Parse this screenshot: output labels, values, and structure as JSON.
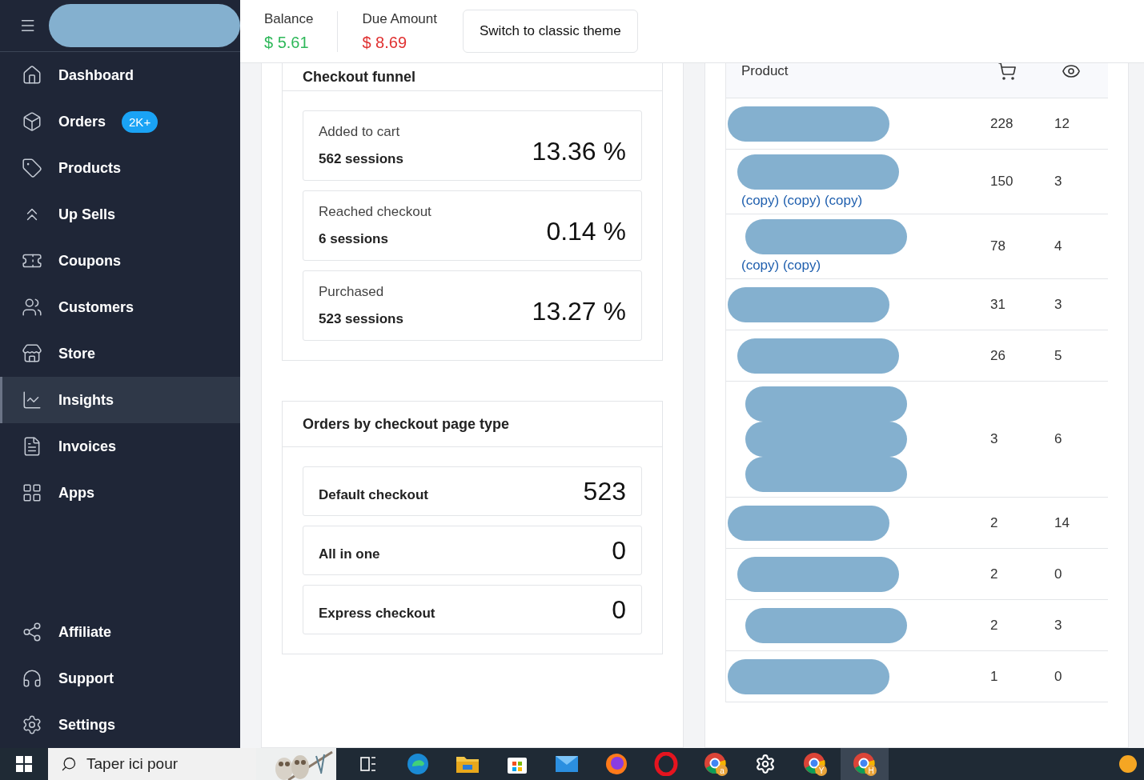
{
  "sidebar": {
    "items": [
      {
        "label": "Dashboard",
        "selected": false
      },
      {
        "label": "Orders",
        "selected": false,
        "badge": "2K+"
      },
      {
        "label": "Products",
        "selected": false
      },
      {
        "label": "Up Sells",
        "selected": false
      },
      {
        "label": "Coupons",
        "selected": false
      },
      {
        "label": "Customers",
        "selected": false
      },
      {
        "label": "Store",
        "selected": false
      },
      {
        "label": "Insights",
        "selected": true
      },
      {
        "label": "Invoices",
        "selected": false
      },
      {
        "label": "Apps",
        "selected": false
      }
    ],
    "bottom_items": [
      {
        "label": "Affiliate",
        "selected": false
      },
      {
        "label": "Support",
        "selected": false
      },
      {
        "label": "Settings",
        "selected": false
      }
    ]
  },
  "header": {
    "stats": [
      {
        "label": "Balance",
        "value": "$ 5.61",
        "color": "#2fb85a"
      },
      {
        "label": "Due Amount",
        "value": "$ 8.69",
        "color": "#e03131"
      }
    ],
    "theme_button": "Switch to classic theme"
  },
  "funnel": {
    "title": "Checkout funnel",
    "steps": [
      {
        "label": "Added to cart",
        "sessions": "562 sessions",
        "percent": "13.36 %"
      },
      {
        "label": "Reached checkout",
        "sessions": "6 sessions",
        "percent": "0.14 %"
      },
      {
        "label": "Purchased",
        "sessions": "523 sessions",
        "percent": "13.27 %"
      }
    ]
  },
  "checkout_types": {
    "title": "Orders by checkout page type",
    "rows": [
      {
        "label": "Default checkout",
        "value": "523"
      },
      {
        "label": "All in one",
        "value": "0"
      },
      {
        "label": "Express checkout",
        "value": "0"
      }
    ]
  },
  "products": {
    "columns": [
      "Product"
    ],
    "rows": [
      {
        "kind": "single",
        "cart": "228",
        "views": "12"
      },
      {
        "kind": "single",
        "name": "(copy) (copy) (copy)",
        "cart": "150",
        "views": "3"
      },
      {
        "kind": "single",
        "name": "(copy) (copy)",
        "cart": "78",
        "views": "4"
      },
      {
        "kind": "single",
        "cart": "31",
        "views": "3"
      },
      {
        "kind": "single",
        "cart": "26",
        "views": "5"
      },
      {
        "kind": "stacked",
        "cart": "3",
        "views": "6"
      },
      {
        "kind": "single",
        "cart": "2",
        "views": "14"
      },
      {
        "kind": "single",
        "cart": "2",
        "views": "0"
      },
      {
        "kind": "single",
        "cart": "2",
        "views": "3"
      },
      {
        "kind": "single",
        "cart": "1",
        "views": "0"
      }
    ]
  },
  "taskbar": {
    "search_placeholder": "Taper ici pour",
    "apps": [
      {
        "kind": "taskview",
        "selected": false
      },
      {
        "kind": "edge",
        "selected": false
      },
      {
        "kind": "folder",
        "selected": false
      },
      {
        "kind": "store",
        "selected": false
      },
      {
        "kind": "mail",
        "selected": false
      },
      {
        "kind": "firefox",
        "selected": false
      },
      {
        "kind": "opera",
        "selected": false
      },
      {
        "kind": "chrome",
        "profile": "a",
        "selected": false
      },
      {
        "kind": "gear",
        "selected": false
      },
      {
        "kind": "chrome",
        "profile": "Y",
        "selected": false
      },
      {
        "kind": "chrome",
        "profile": "H",
        "selected": true
      }
    ]
  }
}
